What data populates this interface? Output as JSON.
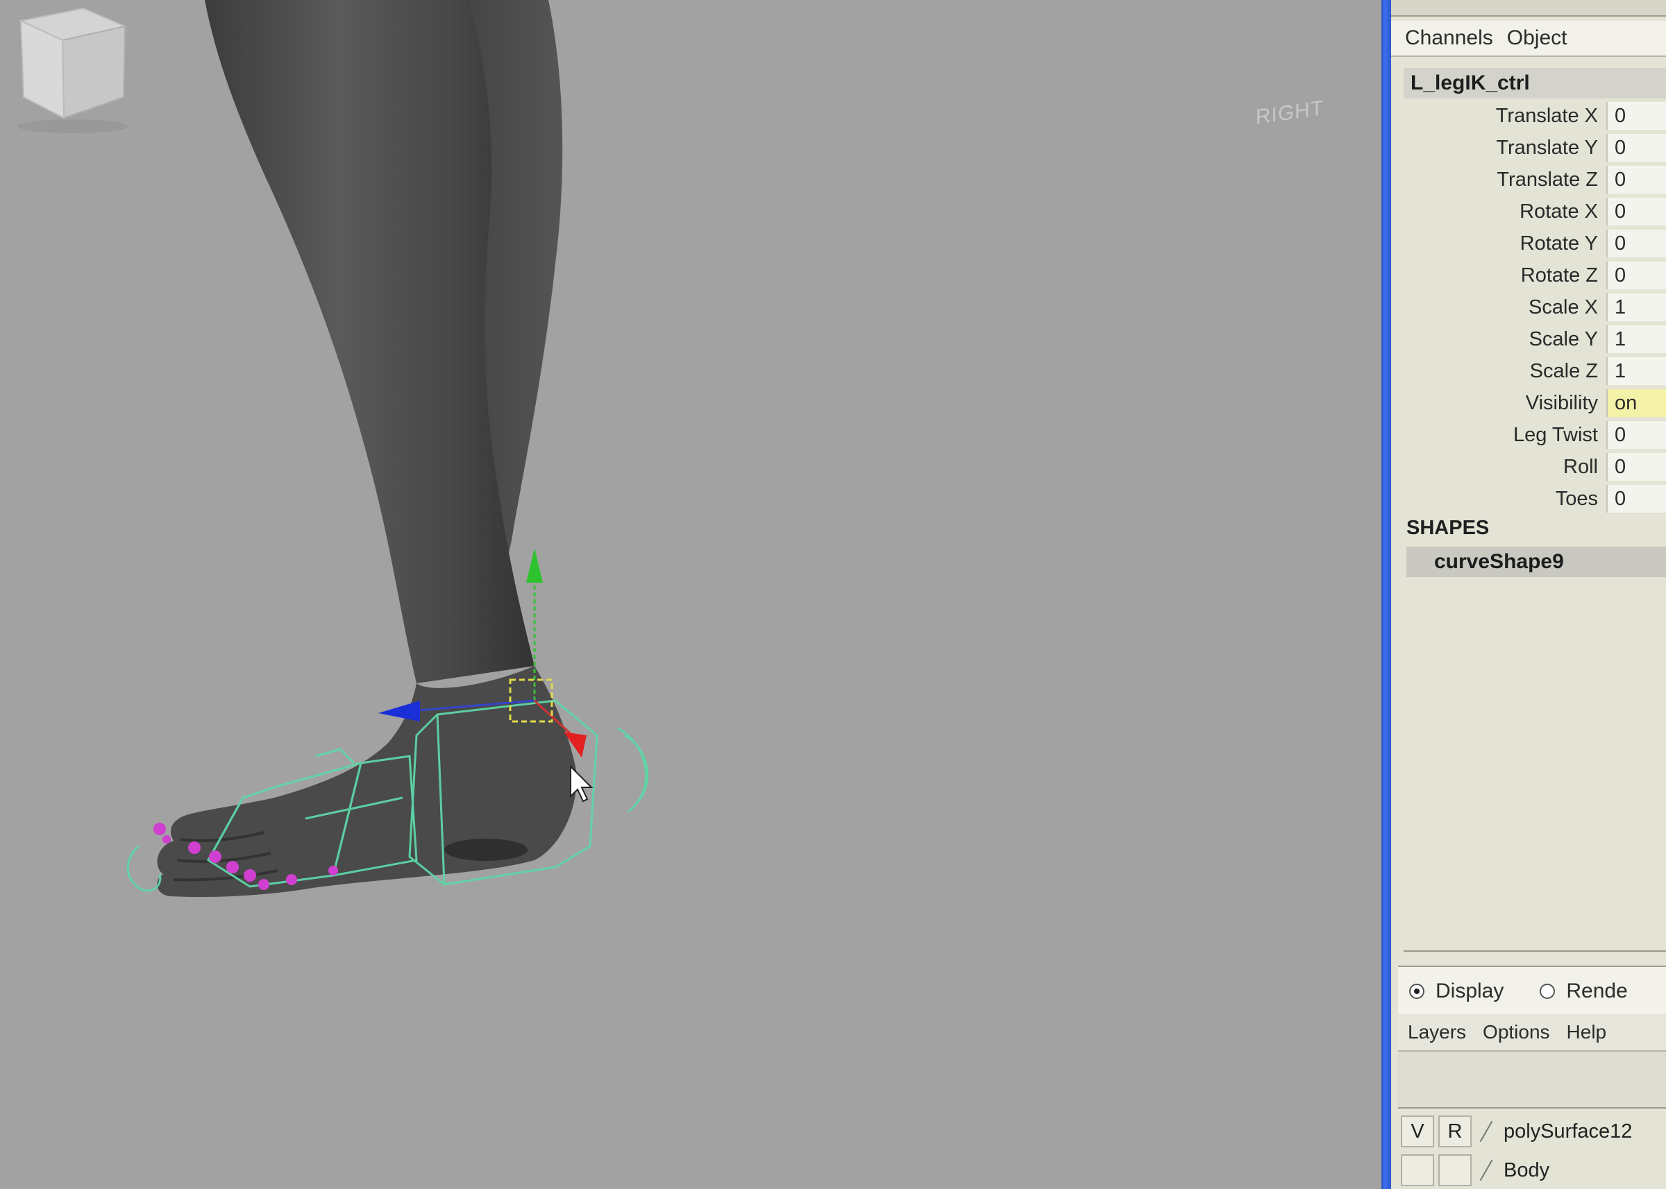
{
  "viewport": {
    "view_cube_label": "RIGHT"
  },
  "channel_box": {
    "menu": [
      "Channels",
      "Object"
    ],
    "node_name": "L_legIK_ctrl",
    "attributes": [
      {
        "label": "Translate X",
        "value": "0"
      },
      {
        "label": "Translate Y",
        "value": "0"
      },
      {
        "label": "Translate Z",
        "value": "0"
      },
      {
        "label": "Rotate X",
        "value": "0"
      },
      {
        "label": "Rotate Y",
        "value": "0"
      },
      {
        "label": "Rotate Z",
        "value": "0"
      },
      {
        "label": "Scale X",
        "value": "1"
      },
      {
        "label": "Scale Y",
        "value": "1"
      },
      {
        "label": "Scale Z",
        "value": "1"
      },
      {
        "label": "Visibility",
        "value": "on"
      },
      {
        "label": "Leg Twist",
        "value": "0"
      },
      {
        "label": "Roll",
        "value": "0"
      },
      {
        "label": "Toes",
        "value": "0"
      }
    ],
    "shapes_heading": "SHAPES",
    "shape_name": "curveShape9"
  },
  "layer_editor": {
    "modes": [
      {
        "label": "Display",
        "selected": true
      },
      {
        "label": "Rende",
        "selected": false
      }
    ],
    "menu": [
      "Layers",
      "Options",
      "Help"
    ],
    "layers": [
      {
        "v": "V",
        "r": "R",
        "name": "polySurface12"
      },
      {
        "v": "",
        "r": "",
        "name": "Body"
      }
    ]
  },
  "colors": {
    "viewport_bg": "#a2a2a2",
    "panel_bg": "#e3e3d6",
    "divider": "#3d6ef0",
    "rig_curve": "#5ed6a8",
    "toe_controls": "#d040d0"
  }
}
